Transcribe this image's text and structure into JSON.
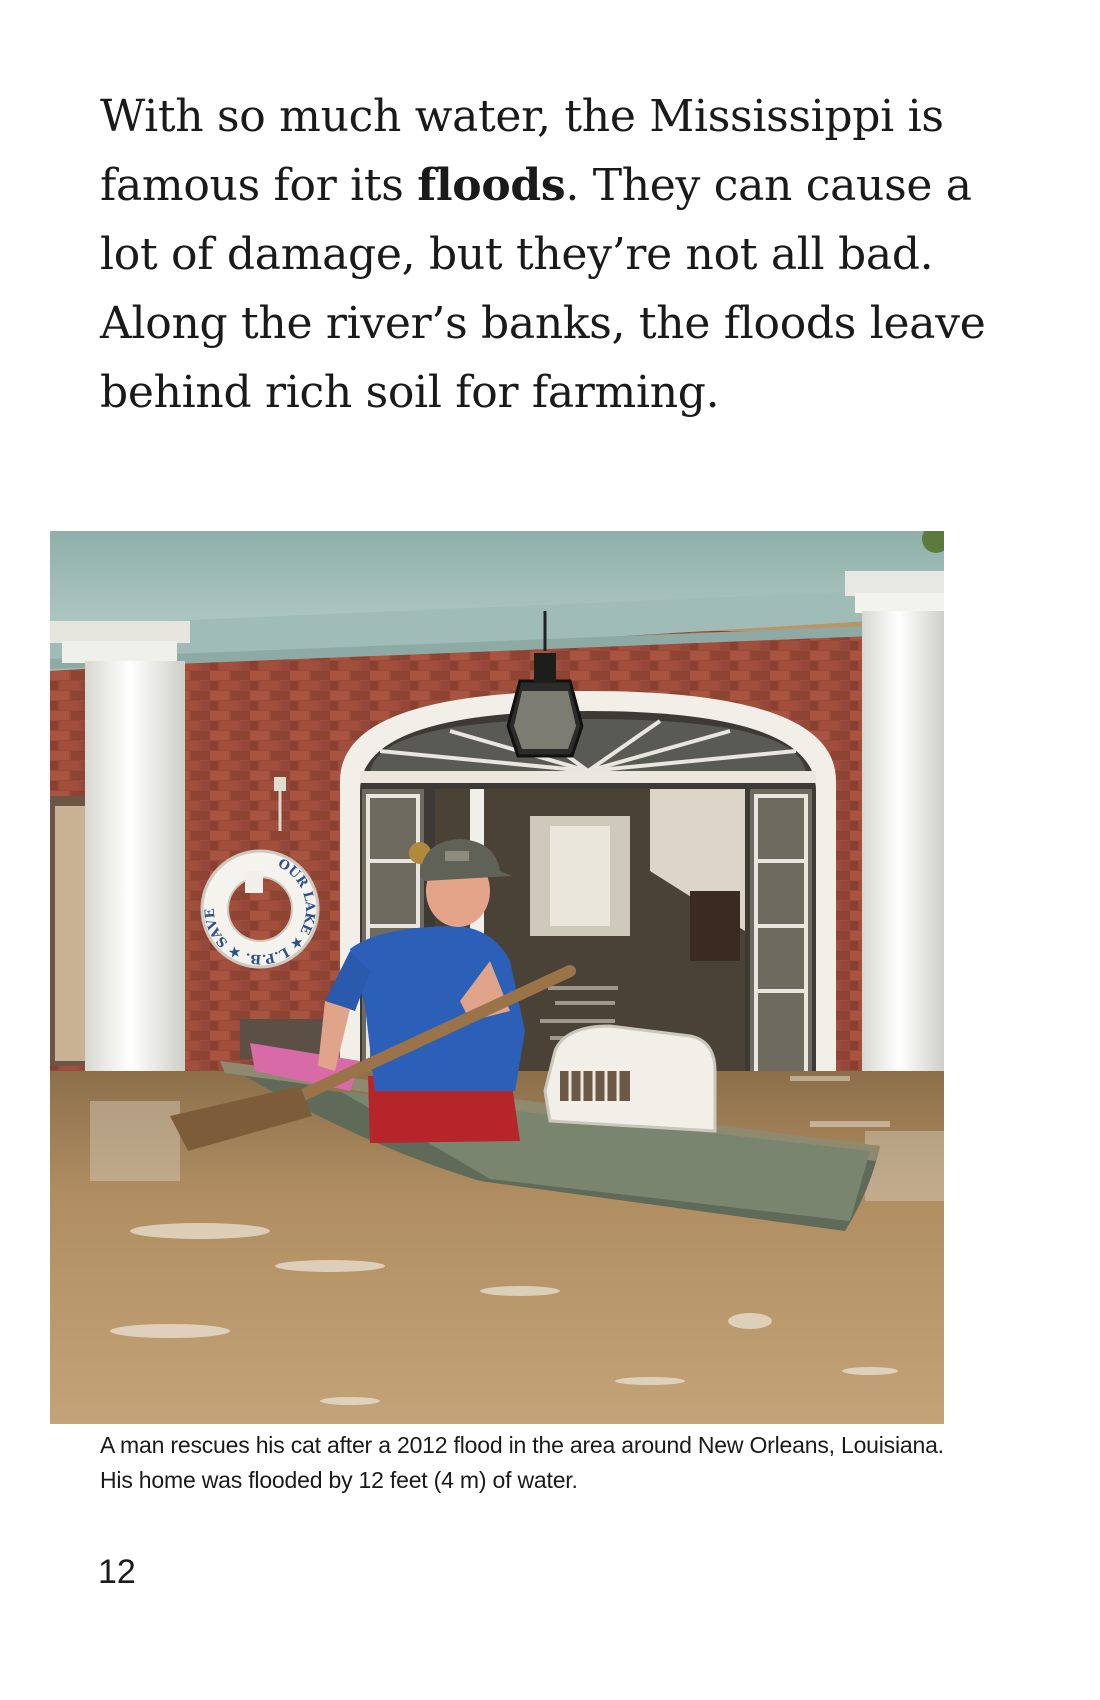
{
  "body": {
    "text_before": "With so much water, the Mississippi is famous for its ",
    "bold_term": "floods",
    "text_after": ". They can cause a lot of damage, but they’re not all bad. Along the river’s banks, the floods leave behind rich soil for farming."
  },
  "photo": {
    "life_ring_text": "OUR LAKE ★ L.P.B. ★ SAVE"
  },
  "caption": {
    "text": "A man rescues his cat after a 2012 flood in the area around New Orleans, Louisiana. His home was flooded by 12 feet (4 m) of water."
  },
  "page_number": "12",
  "colors": {
    "text": "#1a1a1a",
    "brick": "#9a4a38",
    "ceiling": "#a9c3bd",
    "water": "#b59466",
    "shirt": "#2c5fb8",
    "shorts": "#b5252a"
  }
}
